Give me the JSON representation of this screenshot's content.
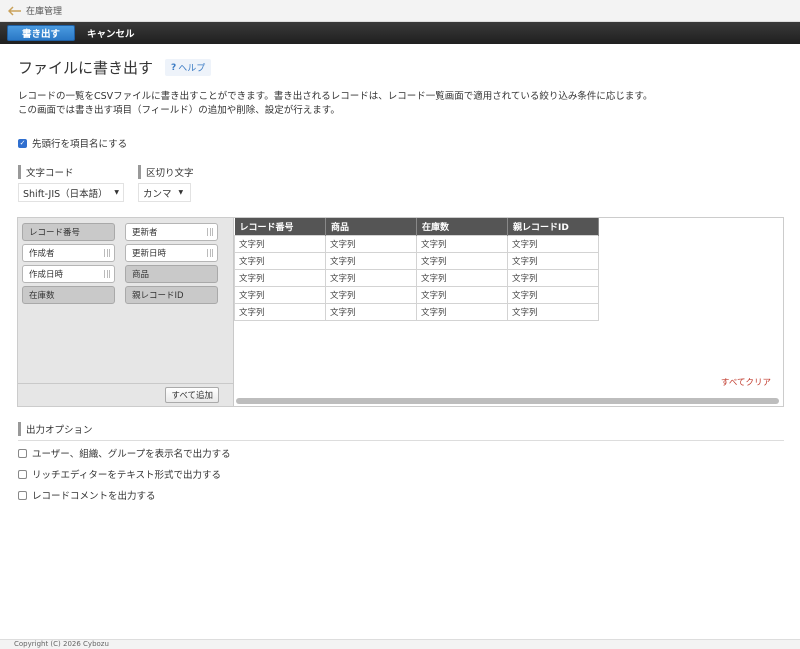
{
  "header": {
    "app_title": "在庫管理"
  },
  "toolbar": {
    "export_label": "書き出す",
    "cancel_label": "キャンセル"
  },
  "page": {
    "title": "ファイルに書き出す",
    "help_label": "ヘルプ",
    "description_line1": "レコードの一覧をCSVファイルに書き出すことができます。書き出されるレコードは、レコード一覧画面で適用されている絞り込み条件に応じます。",
    "description_line2": "この画面では書き出す項目（フィールド）の追加や削除、設定が行えます。"
  },
  "header_row_option": {
    "label": "先頭行を項目名にする",
    "checked": true
  },
  "encoding": {
    "label": "文字コード",
    "value": "Shift-JIS（日本語）"
  },
  "delimiter": {
    "label": "区切り文字",
    "value": "カンマ"
  },
  "palette": {
    "left": [
      {
        "label": "レコード番号",
        "used": true
      },
      {
        "label": "作成者",
        "used": false
      },
      {
        "label": "作成日時",
        "used": false
      },
      {
        "label": "在庫数",
        "used": true
      }
    ],
    "right": [
      {
        "label": "更新者",
        "used": false
      },
      {
        "label": "更新日時",
        "used": false
      },
      {
        "label": "商品",
        "used": true
      },
      {
        "label": "親レコードID",
        "used": true
      }
    ],
    "add_all_label": "すべて追加"
  },
  "preview": {
    "columns": [
      "レコード番号",
      "商品",
      "在庫数",
      "親レコードID"
    ],
    "cell_text": "文字列",
    "row_count": 5,
    "clear_all_label": "すべてクリア"
  },
  "output_options": {
    "section_label": "出力オプション",
    "items": [
      {
        "label": "ユーザー、組織、グループを表示名で出力する",
        "checked": false
      },
      {
        "label": "リッチエディターをテキスト形式で出力する",
        "checked": false
      },
      {
        "label": "レコードコメントを出力する",
        "checked": false
      }
    ]
  },
  "footer": {
    "copyright": "Copyright (C) 2026 Cybozu"
  },
  "colors": {
    "accent": "#2a78c6",
    "danger": "#c0392b",
    "header_dark": "#555555"
  }
}
